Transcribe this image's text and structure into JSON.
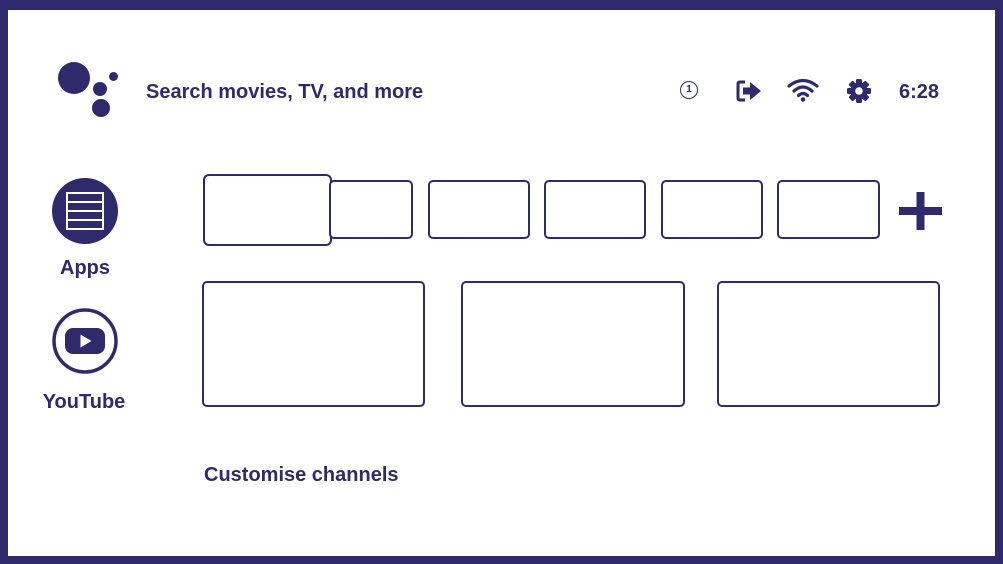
{
  "theme": {
    "accent": "#2e2a6b",
    "background": "#ffffff"
  },
  "header": {
    "search_placeholder": "Search movies, TV, and more",
    "notification_count": "1",
    "clock": "6:28",
    "icons": [
      "assistant-icon",
      "notification-icon",
      "input-source-icon",
      "wifi-icon",
      "settings-icon"
    ]
  },
  "sidebar": {
    "items": [
      {
        "label": "Apps",
        "icon": "apps-icon"
      },
      {
        "label": "YouTube",
        "icon": "youtube-icon"
      }
    ]
  },
  "favorites": {
    "tile_count": 6,
    "focused_index": 0,
    "add_icon": "plus-icon"
  },
  "channel_row": {
    "tile_count": 3
  },
  "footer": {
    "customise_label": "Customise channels"
  }
}
